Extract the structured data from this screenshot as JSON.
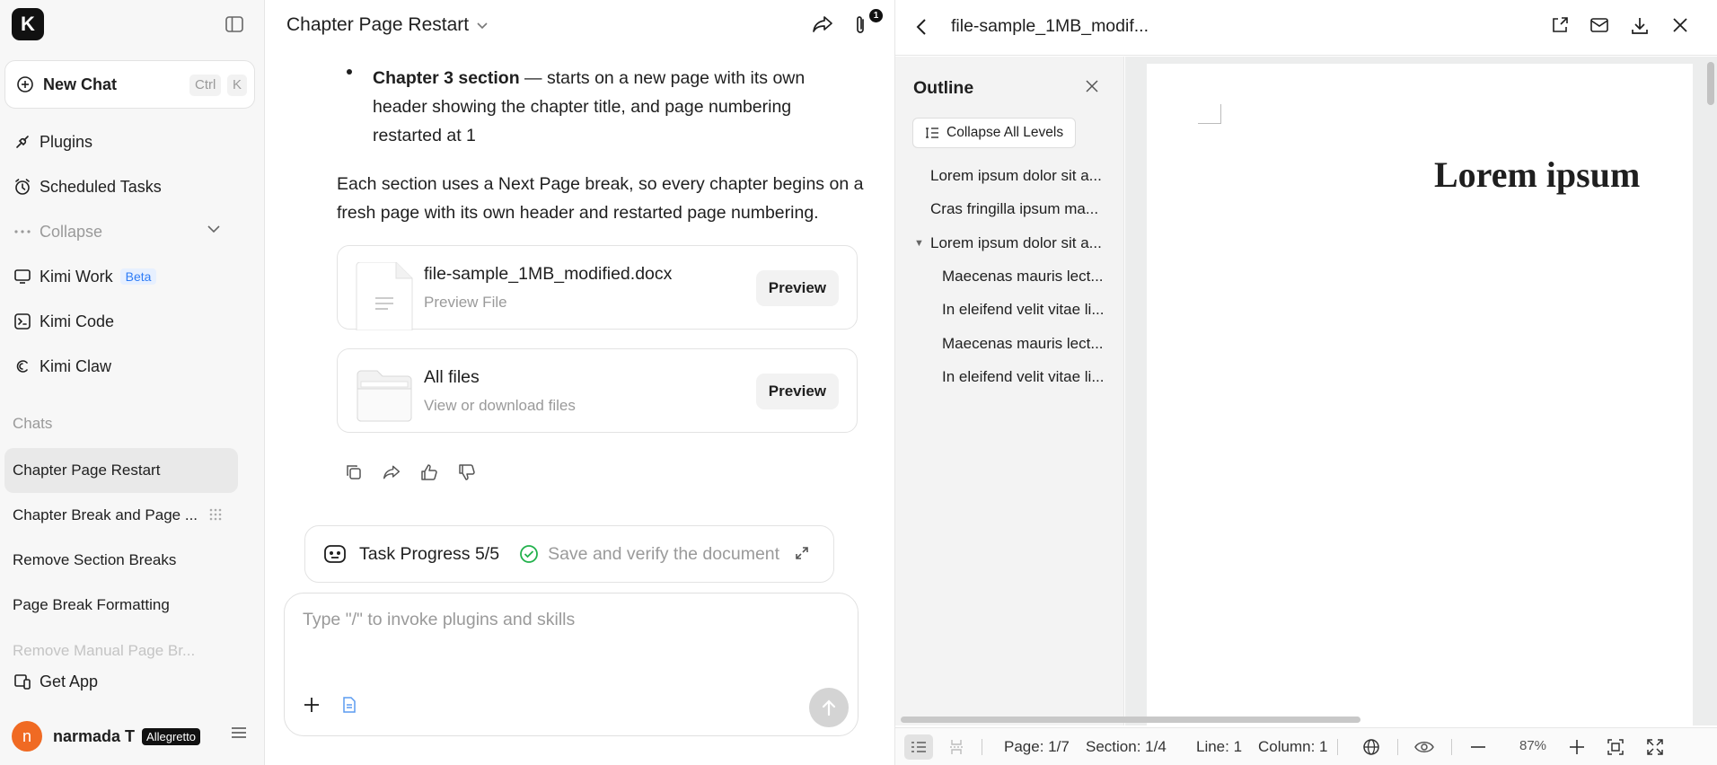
{
  "sidebar": {
    "logo": "K",
    "new_chat": {
      "label": "New Chat",
      "key1": "Ctrl",
      "key2": "K"
    },
    "nav": [
      {
        "label": "Plugins"
      },
      {
        "label": "Scheduled Tasks"
      },
      {
        "label": "Collapse"
      },
      {
        "label": "Kimi Work",
        "badge": "Beta"
      },
      {
        "label": "Kimi Code"
      },
      {
        "label": "Kimi Claw"
      }
    ],
    "chats_heading": "Chats",
    "chats": [
      {
        "label": "Chapter Page Restart"
      },
      {
        "label": "Chapter Break and Page ..."
      },
      {
        "label": "Remove Section Breaks"
      },
      {
        "label": "Page Break Formatting"
      },
      {
        "label": "Remove Manual Page Br..."
      }
    ],
    "get_app": "Get App",
    "user": {
      "initial": "n",
      "name": "narmada T",
      "plan": "Allegretto"
    }
  },
  "chat": {
    "title": "Chapter Page Restart",
    "attach_count": "1",
    "chapter3_bold": "Chapter 3 section",
    "chapter3_rest": " — starts on a new page with its own header showing the chapter title, and page numbering restarted at 1",
    "summary": "Each section uses a Next Page break, so every chapter begins on a fresh page with its own header and restarted page numbering.",
    "files": [
      {
        "name": "file-sample_1MB_modified.docx",
        "sub": "Preview File",
        "action": "Preview"
      },
      {
        "name": "All files",
        "sub": "View or download files",
        "action": "Preview"
      }
    ],
    "task": {
      "label": "Task Progress 5/5",
      "step": "Save and verify the document"
    },
    "composer": {
      "placeholder": "Type \"/\" to invoke plugins and skills"
    }
  },
  "preview": {
    "filename": "file-sample_1MB_modif...",
    "outline": {
      "title": "Outline",
      "collapse_label": "Collapse All Levels",
      "items": [
        "Lorem ipsum dolor sit a...",
        "Cras fringilla ipsum ma...",
        "Lorem ipsum dolor sit a...",
        "Maecenas mauris lect...",
        "In eleifend velit vitae li...",
        "Maecenas mauris lect...",
        "In eleifend velit vitae li..."
      ]
    },
    "document": {
      "heading": "Lorem ipsum"
    },
    "status": {
      "page": "Page: 1/7",
      "section": "Section: 1/4",
      "line": "Line: 1",
      "column": "Column: 1",
      "zoom": "87%"
    }
  },
  "colors": {
    "avatar": "#f06a23",
    "beta": "#2e7cf6",
    "check": "#22b14c"
  }
}
